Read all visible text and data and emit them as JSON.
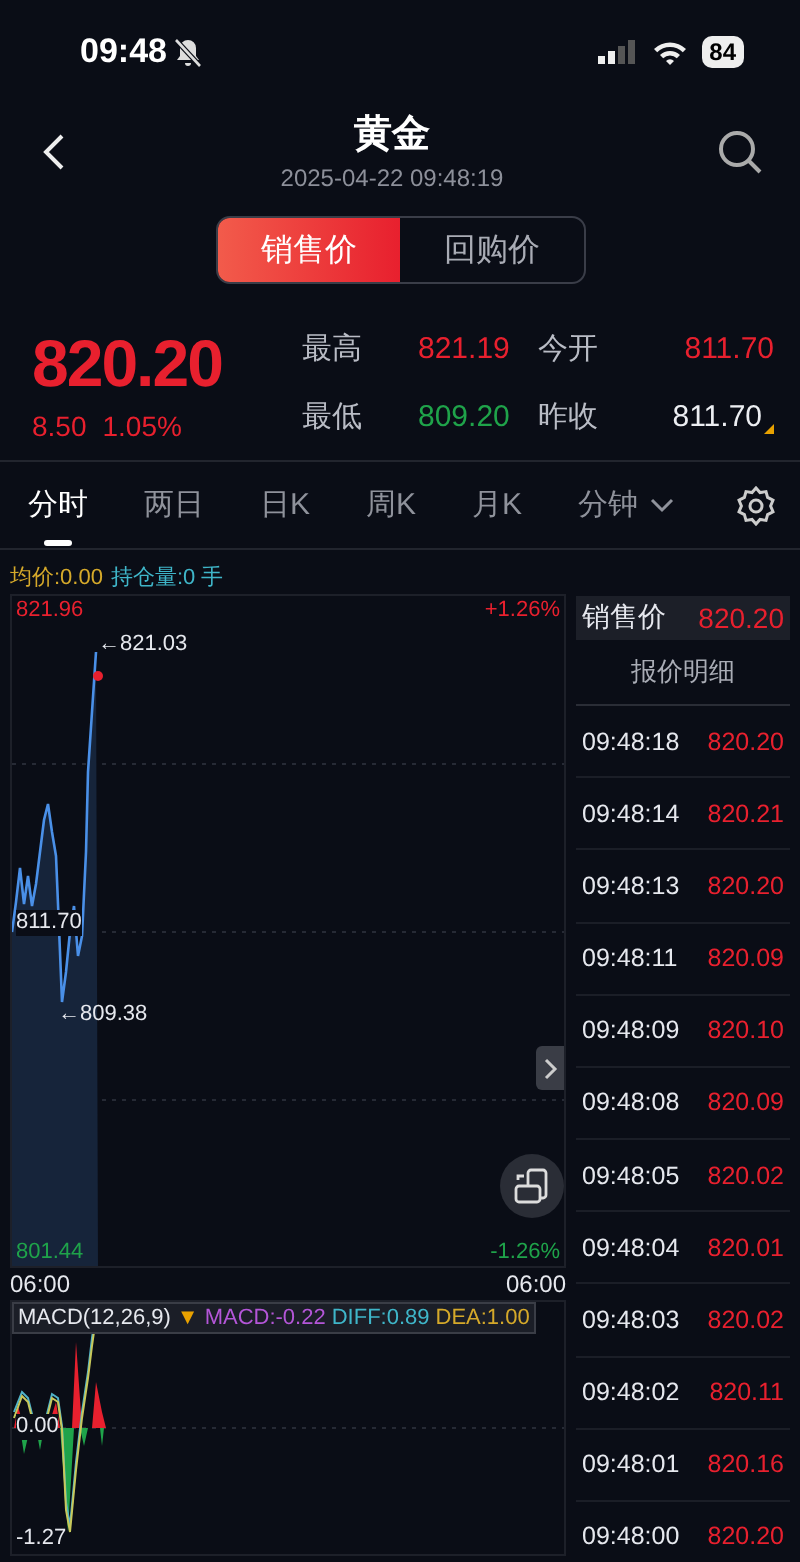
{
  "status_bar": {
    "time": "09:48",
    "battery": "84"
  },
  "header": {
    "title": "黄金",
    "timestamp": "2025-04-22 09:48:19"
  },
  "price_type_tabs": [
    {
      "label": "销售价",
      "selected": true
    },
    {
      "label": "回购价",
      "selected": false
    }
  ],
  "quote": {
    "price": "820.20",
    "change": "8.50",
    "change_pct": "1.05%",
    "stats": [
      {
        "label": "最高",
        "value": "821.19",
        "color": "#e8202e",
        "flagged": false
      },
      {
        "label": "今开",
        "value": "811.70",
        "color": "#e8202e",
        "flagged": false
      },
      {
        "label": "最低",
        "value": "809.20",
        "color": "#1fa34a",
        "flagged": false
      },
      {
        "label": "昨收",
        "value": "811.70",
        "color": "#eceef2",
        "flagged": true
      }
    ]
  },
  "period_tabs": [
    {
      "label": "分时",
      "selected": true,
      "kind": "tab"
    },
    {
      "label": "两日",
      "selected": false,
      "kind": "tab"
    },
    {
      "label": "日K",
      "selected": false,
      "kind": "tab"
    },
    {
      "label": "周K",
      "selected": false,
      "kind": "tab"
    },
    {
      "label": "月K",
      "selected": false,
      "kind": "tab"
    },
    {
      "label": "分钟",
      "selected": false,
      "kind": "dropdown"
    }
  ],
  "chart": {
    "avg_price": "均价:0.00",
    "position": "持仓量:0 手",
    "y_max": "821.96",
    "y_min": "801.44",
    "pct_max": "+1.26%",
    "pct_min": "-1.26%",
    "high_mark": "←821.03",
    "low_mark": "←809.38",
    "prev_close": "811.70",
    "time_start": "06:00",
    "time_end": "06:00"
  },
  "macd": {
    "label": "MACD(12,26,9)",
    "marker": "▼",
    "macd": "MACD:-0.22",
    "diff": "DIFF:0.89",
    "dea": "DEA:1.00",
    "zero": "0.00",
    "min": "-1.27"
  },
  "ticker": {
    "label": "销售价",
    "price": "820.20",
    "title": "报价明细",
    "rows": [
      {
        "time": "09:48:18",
        "price": "820.20"
      },
      {
        "time": "09:48:14",
        "price": "820.21"
      },
      {
        "time": "09:48:13",
        "price": "820.20"
      },
      {
        "time": "09:48:11",
        "price": "820.09"
      },
      {
        "time": "09:48:09",
        "price": "820.10"
      },
      {
        "time": "09:48:08",
        "price": "820.09"
      },
      {
        "time": "09:48:05",
        "price": "820.02"
      },
      {
        "time": "09:48:04",
        "price": "820.01"
      },
      {
        "time": "09:48:03",
        "price": "820.02"
      },
      {
        "time": "09:48:02",
        "price": "820.11"
      },
      {
        "time": "09:48:01",
        "price": "820.16"
      },
      {
        "time": "09:48:00",
        "price": "820.20"
      }
    ]
  }
}
